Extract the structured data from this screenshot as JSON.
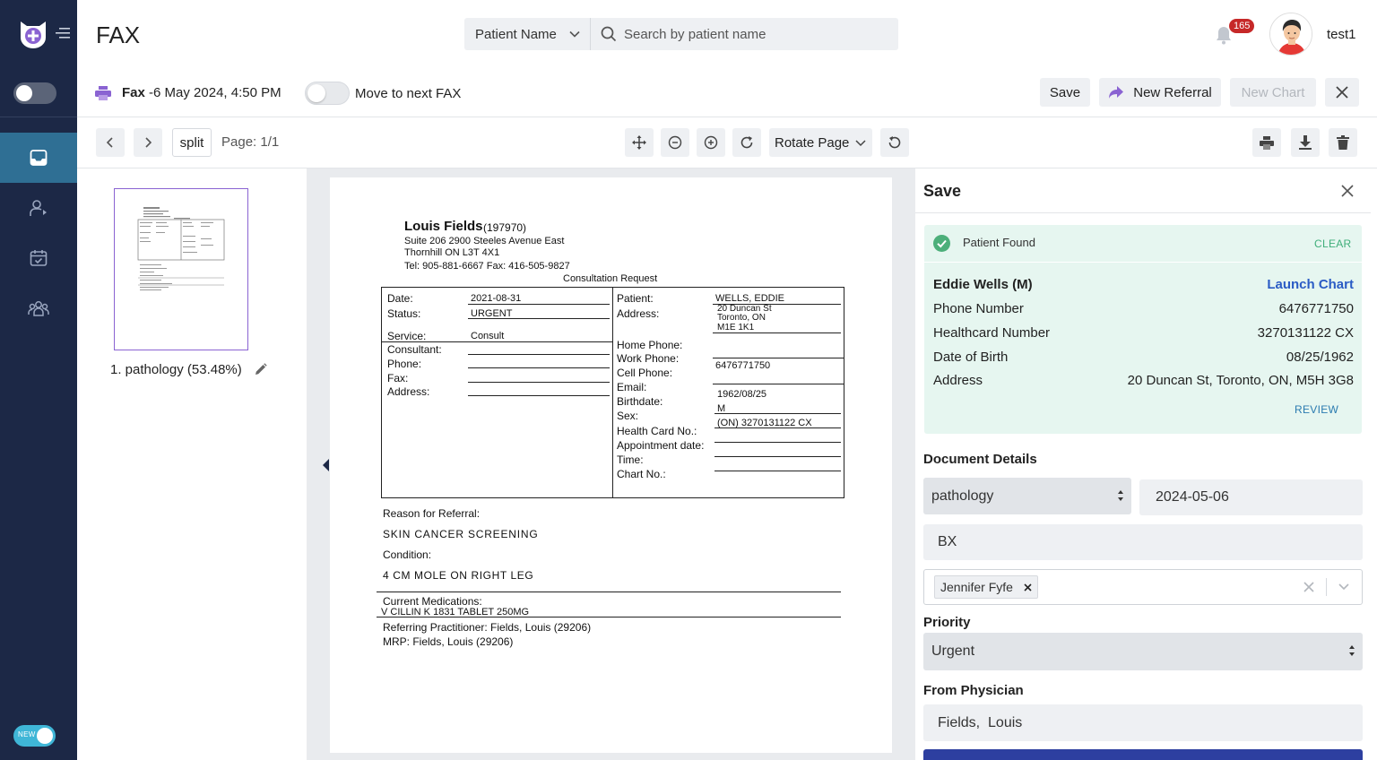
{
  "app": {
    "title": "FAX"
  },
  "search": {
    "type_label": "Patient Name",
    "placeholder": "Search by patient name"
  },
  "header": {
    "notification_count": "165",
    "username": "test1"
  },
  "fax": {
    "label": "Fax",
    "date": "-6 May 2024, 4:50 PM",
    "move_label": "Move to next FAX"
  },
  "actions": {
    "save": "Save",
    "new_referral": "New Referral",
    "new_chart": "New Chart"
  },
  "toolbar": {
    "split": "split",
    "page": "Page: 1/1",
    "rotate_label": "Rotate Page"
  },
  "thumbnail": {
    "caption": "1. pathology (53.48%)"
  },
  "document": {
    "sender_name": "Louis Fields",
    "sender_id": "(197970)",
    "address1": "Suite 206 2900 Steeles Avenue East",
    "address2": "Thornhill ON L3T 4X1",
    "contact": "Tel: 905-881-6667 Fax: 416-505-9827",
    "heading": "Consultation Request",
    "left_labels": {
      "date": "Date:",
      "status": "Status:",
      "service": "Service:",
      "consultant": "Consultant:",
      "phone": "Phone:",
      "fax": "Fax:",
      "address": "Address:"
    },
    "left_values": {
      "date": "2021-08-31",
      "status": "URGENT",
      "service": "Consult"
    },
    "right_labels": {
      "patient": "Patient:",
      "address": "Address:",
      "home_phone": "Home Phone:",
      "work_phone": "Work Phone:",
      "cell_phone": "Cell Phone:",
      "email": "Email:",
      "birthdate": "Birthdate:",
      "sex": "Sex:",
      "health_card": "Health Card No.:",
      "appointment": "Appointment date:",
      "time": "Time:",
      "chart": "Chart No.:"
    },
    "right_values": {
      "patient": "WELLS, EDDIE",
      "addr1": "20 Duncan St",
      "addr2": "Toronto, ON",
      "addr3": "M1E 1K1",
      "cell_phone": "6476771750",
      "birthdate": "1962/08/25",
      "sex": "M",
      "health_card": "(ON) 3270131122 CX"
    },
    "reason_label": "Reason for Referral:",
    "reason": "SKIN CANCER SCREENING",
    "condition_label": "Condition:",
    "condition": "4 CM MOLE ON RIGHT LEG",
    "meds_label": "Current Medications:",
    "meds": "V CILLIN K 1831 TABLET 250MG",
    "referring": "Referring Practitioner: Fields, Louis (29206)",
    "mrp": "MRP: Fields, Louis (29206)"
  },
  "panel": {
    "title": "Save",
    "found_text": "Patient Found",
    "clear": "CLEAR",
    "patient_name": "Eddie Wells (M)",
    "launch_chart": "Launch Chart",
    "rows": [
      {
        "label": "Phone Number",
        "value": "6476771750"
      },
      {
        "label": "Healthcard Number",
        "value": "3270131122 CX"
      },
      {
        "label": "Date of Birth",
        "value": "08/25/1962"
      },
      {
        "label": "Address",
        "value": "20 Duncan St, Toronto, ON, M5H 3G8"
      }
    ],
    "review": "REVIEW",
    "doc_details_label": "Document Details",
    "doc_type": "pathology",
    "doc_date": "2024-05-06",
    "description": "BX",
    "recipient_tag": "Jennifer Fyfe",
    "priority_label": "Priority",
    "priority": "Urgent",
    "from_physician_label": "From Physician",
    "from_physician": "Fields,  Louis"
  },
  "sidebar": {
    "new_label": "NEW"
  },
  "colors": {
    "sidebar": "#1c2846",
    "active_nav": "#2f6f94",
    "accent_purple": "#8a63d2",
    "found_bg": "#e6f6f0",
    "link_blue": "#2b5cc5",
    "badge_red": "#c62828"
  }
}
